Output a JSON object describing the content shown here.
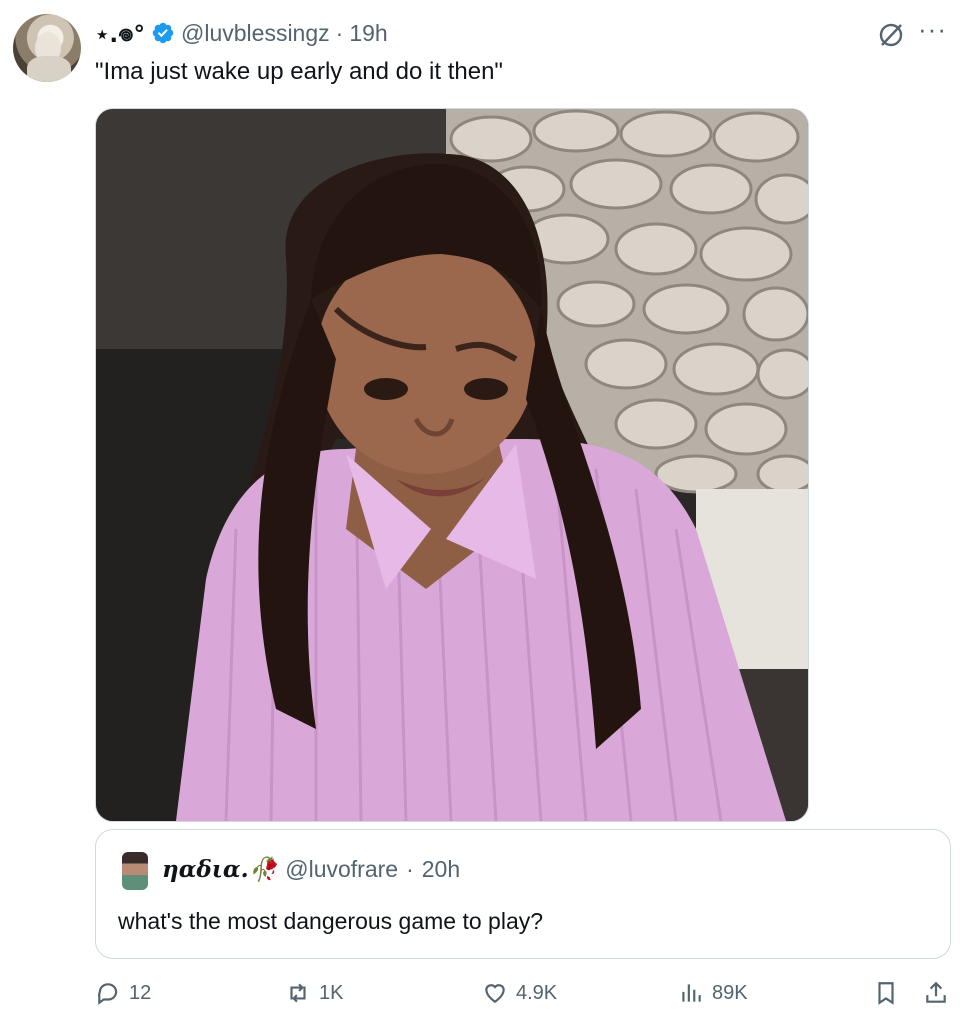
{
  "author": {
    "display_name": "⋆.𖦹°",
    "handle": "@luvblessingz",
    "separator": "·",
    "time": "19h"
  },
  "tweet": {
    "text": "\"Ima just wake up early and do it then\""
  },
  "quoted": {
    "display_name": "ηαδια.🥀",
    "handle": "@luvofrare",
    "separator": "·",
    "time": "20h",
    "text": "what's the most dangerous game to play?"
  },
  "actions": {
    "replies": "12",
    "reposts": "1K",
    "likes": "4.9K",
    "views": "89K"
  },
  "colors": {
    "verified": "#1d9bf0",
    "muted": "#536471",
    "border": "#cfd9de"
  },
  "icons": [
    "grok-icon",
    "more-icon",
    "reply-icon",
    "repost-icon",
    "like-icon",
    "views-icon",
    "bookmark-icon",
    "share-icon",
    "verified-badge-icon"
  ]
}
